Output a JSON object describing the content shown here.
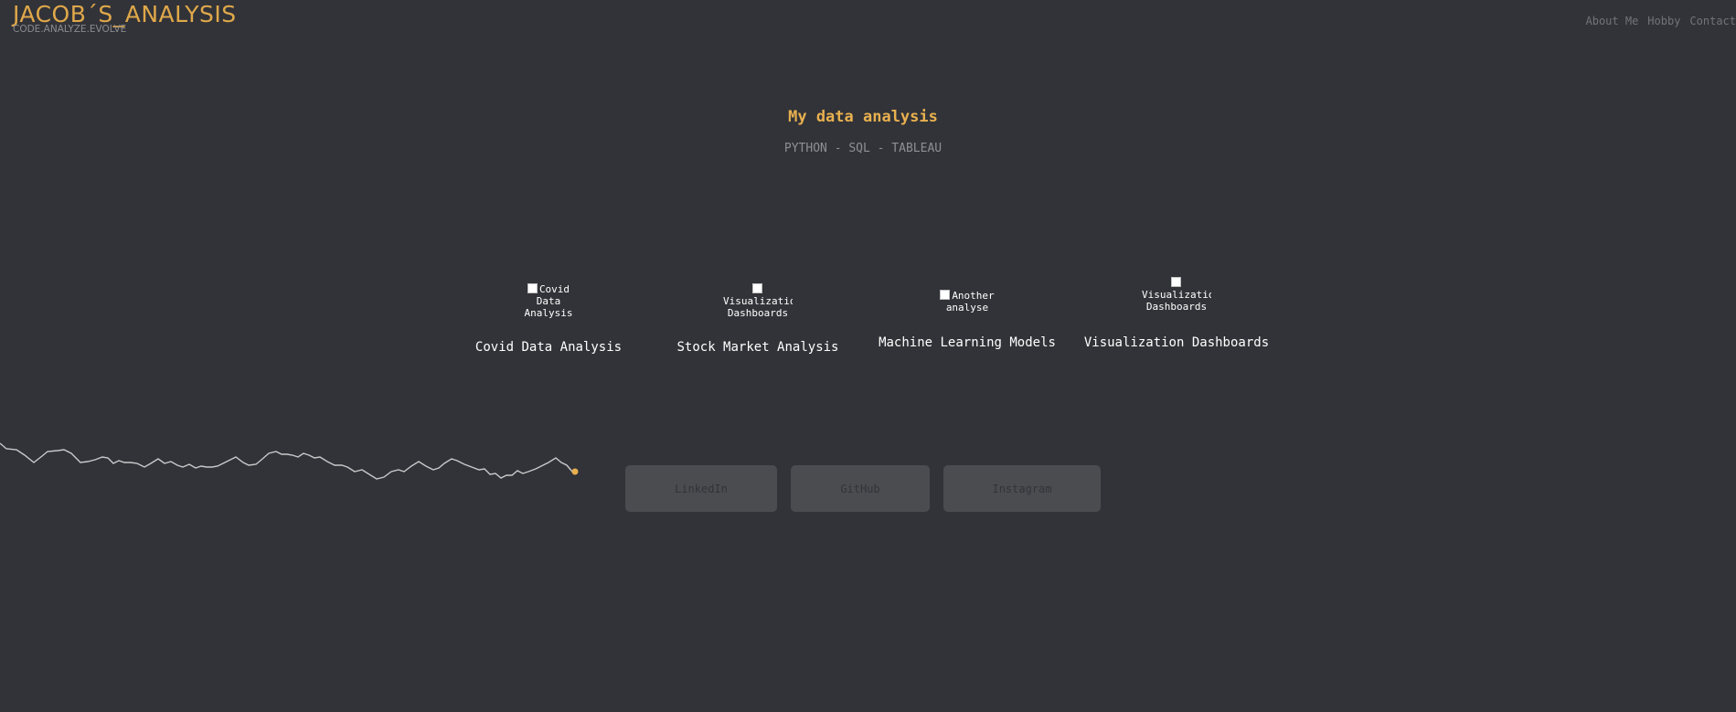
{
  "header": {
    "logo_title": "JACOB´S_ANALYSIS",
    "logo_tagline": "CODE.ANALYZE.EVOLVE",
    "nav": [
      "About Me",
      "Hobby",
      "Contact"
    ]
  },
  "hero": {
    "title": "My data analysis",
    "subtitle": "PYTHON - SQL - TABLEAU"
  },
  "projects": [
    {
      "img_alt": "Covid Data Analysis",
      "title": "Covid Data Analysis"
    },
    {
      "img_alt": "Visualization Dashboards",
      "title": "Stock Market Analysis"
    },
    {
      "img_alt": "Another analyse",
      "title": "Machine Learning Models"
    },
    {
      "img_alt": "Visualization Dashboards",
      "title": "Visualization Dashboards"
    }
  ],
  "social_links": [
    "LinkedIn",
    "GitHub",
    "Instagram"
  ],
  "colors": {
    "background": "#323338",
    "accent": "#e0a84a",
    "sparkline_line": "#c9c9cc",
    "sparkline_dot": "#e8b04f",
    "button_bg": "#4b4c50"
  }
}
